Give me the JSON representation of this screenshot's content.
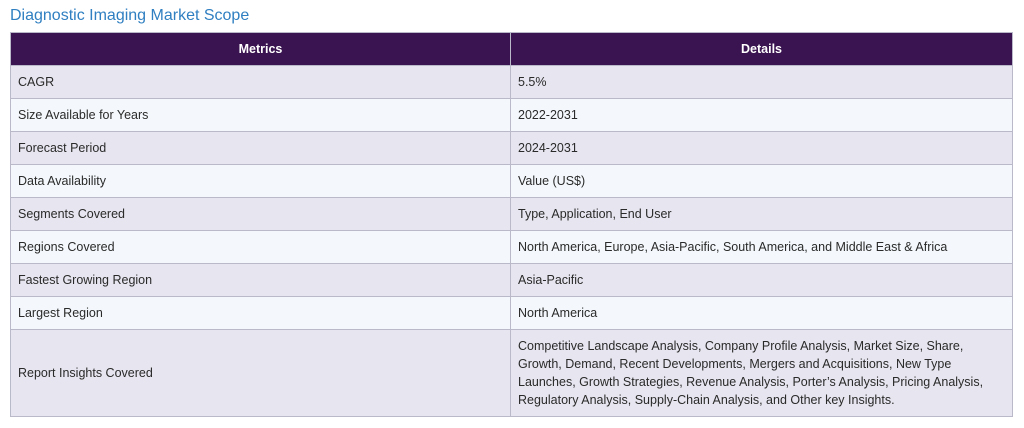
{
  "title": "Diagnostic Imaging Market Scope",
  "table": {
    "headers": [
      "Metrics",
      "Details"
    ],
    "rows": [
      {
        "metric": "CAGR",
        "detail": "5.5%"
      },
      {
        "metric": "Size Available for Years",
        "detail": "2022-2031"
      },
      {
        "metric": "Forecast Period",
        "detail": "2024-2031"
      },
      {
        "metric": "Data Availability",
        "detail": "Value (US$)"
      },
      {
        "metric": "Segments Covered",
        "detail": "Type, Application, End User"
      },
      {
        "metric": "Regions Covered",
        "detail": "North America, Europe, Asia-Pacific, South America, and Middle East & Africa"
      },
      {
        "metric": "Fastest Growing Region",
        "detail": "Asia-Pacific"
      },
      {
        "metric": "Largest Region",
        "detail": "North America"
      },
      {
        "metric": "Report Insights Covered",
        "detail": "Competitive Landscape Analysis, Company Profile Analysis, Market Size, Share, Growth, Demand, Recent Developments, Mergers and Acquisitions, New Type Launches, Growth Strategies, Revenue Analysis, Porter’s Analysis, Pricing Analysis, Regulatory Analysis, Supply-Chain Analysis, and Other key Insights."
      }
    ]
  }
}
